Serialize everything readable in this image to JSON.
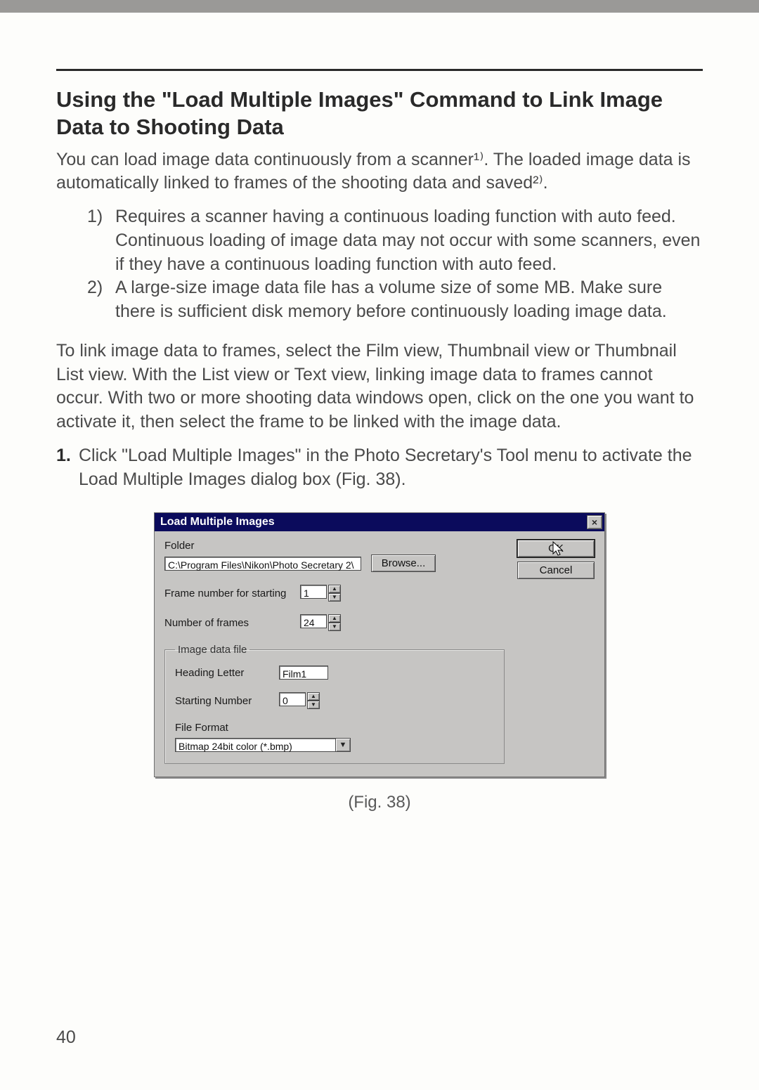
{
  "heading": "Using the \"Load Multiple Images\" Command to Link Image Data to Shooting Data",
  "intro": "You can load image data continuously from a scanner¹⁾. The loaded image data is automatically linked to frames of the shooting data and saved²⁾.",
  "notes": {
    "n1_num": "1)",
    "n1": "Requires a scanner having a continuous loading function with auto feed. Continuous loading of image data may not occur with some scanners, even if they have a continuous loading function with auto feed.",
    "n2_num": "2)",
    "n2": "A large-size image data file has a volume size of some MB. Make sure there is sufficient disk memory before continuously loading image data."
  },
  "para2": "To link image data to frames, select the Film view, Thumbnail view or Thumbnail List view. With the List view or Text view, linking image data to frames cannot occur. With two or more shooting data windows open, click on the one you want to activate it, then select the frame to be linked with the image data.",
  "step1_num": "1.",
  "step1": "Click \"Load Multiple Images\" in the Photo Secretary's Tool menu to activate the Load Multiple Images dialog box (Fig. 38).",
  "dialog": {
    "title": "Load Multiple Images",
    "close_glyph": "×",
    "folder_label": "Folder",
    "folder_path": "C:\\Program Files\\Nikon\\Photo Secretary 2\\",
    "browse": "Browse...",
    "ok": "OK",
    "cancel": "Cancel",
    "frame_start_label": "Frame number for starting",
    "frame_start_value": "1",
    "num_frames_label": "Number of frames",
    "num_frames_value": "24",
    "image_group_legend": "Image data file",
    "heading_letter_label": "Heading Letter",
    "heading_letter_value": "Film1",
    "starting_number_label": "Starting Number",
    "starting_number_value": "0",
    "file_format_label": "File Format",
    "file_format_value": "Bitmap 24bit color (*.bmp)",
    "spin_up": "▲",
    "spin_down": "▼",
    "dropdown_glyph": "▼"
  },
  "caption": "(Fig. 38)",
  "page_number": "40"
}
